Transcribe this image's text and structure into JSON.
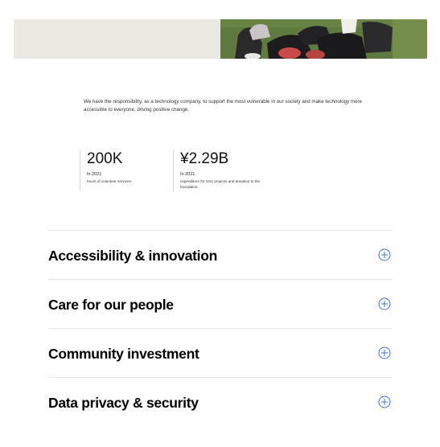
{
  "intro": {
    "text": "We have the responsibility, as a technology company, to support the most vulnerable in our society and make technology more accessible to everyone, driving positive change."
  },
  "stats": [
    {
      "value": "200K",
      "year": "In 2021",
      "description": "hours of volunteer services."
    },
    {
      "value": "¥2.29B",
      "year": "In 2021",
      "description": "expenditure for SSV projects and donation to the foundation."
    }
  ],
  "accordion": {
    "items": [
      {
        "title": "Accessibility & innovation"
      },
      {
        "title": "Care for our people"
      },
      {
        "title": "Community investment"
      },
      {
        "title": "Data privacy & security"
      }
    ],
    "icon": "plus-circle-icon",
    "icon_color": "#3a6fd8"
  },
  "colors": {
    "hero_background": "#ebe8e2"
  }
}
